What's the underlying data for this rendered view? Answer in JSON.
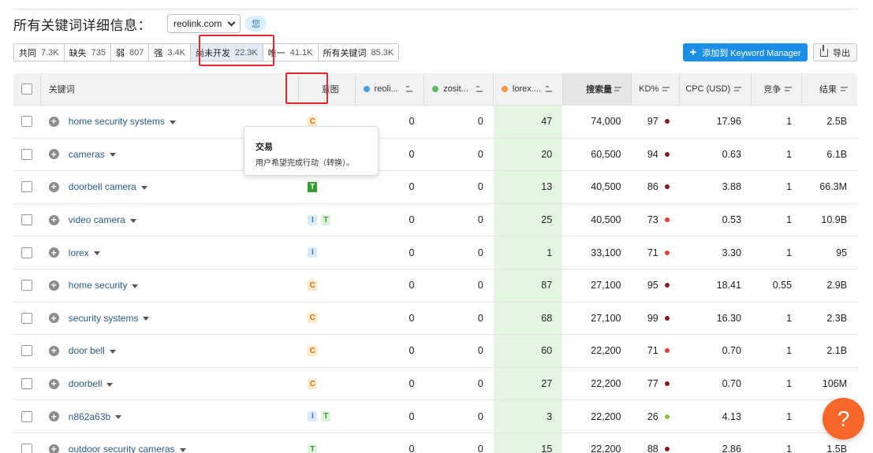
{
  "header": {
    "title": "所有关键词详细信息：",
    "domain": "reolink.com",
    "you_badge": "您"
  },
  "filters": [
    {
      "label": "共同",
      "count": "7.3K"
    },
    {
      "label": "缺失",
      "count": "735"
    },
    {
      "label": "弱",
      "count": "807"
    },
    {
      "label": "强",
      "count": "3.4K"
    },
    {
      "label": "尚未开发",
      "count": "22.3K",
      "active": true
    },
    {
      "label": "唯一",
      "count": "41.1K"
    },
    {
      "label": "所有关键词",
      "count": "85.3K"
    }
  ],
  "actions": {
    "keyword_manager": "添加到 Keyword Manager",
    "export": "导出"
  },
  "table": {
    "headers": {
      "keyword": "关键词",
      "intent": "意图",
      "domain1": "reoli...",
      "domain2": "zosit...",
      "domain3": "lorex....",
      "volume": "搜索量",
      "kd": "KD%",
      "cpc": "CPC (USD)",
      "competition": "竞争",
      "results": "结果"
    },
    "domain_colors": [
      "#4a9ee8",
      "#5cb85c",
      "#f29b38"
    ],
    "rows": [
      {
        "keyword": "home security systems",
        "intents": [
          "C"
        ],
        "d1": "0",
        "d2": "0",
        "d3": "47",
        "volume": "74,000",
        "kd": "97",
        "kd_color": "#8b1a1a",
        "cpc": "17.96",
        "comp": "1",
        "results": "2.5B"
      },
      {
        "keyword": "cameras",
        "intents": [],
        "d1": "0",
        "d2": "0",
        "d3": "20",
        "volume": "60,500",
        "kd": "94",
        "kd_color": "#8b1a1a",
        "cpc": "0.63",
        "comp": "1",
        "results": "6.1B"
      },
      {
        "keyword": "doorbell camera",
        "intents": [
          "T*"
        ],
        "d1": "0",
        "d2": "0",
        "d3": "13",
        "volume": "40,500",
        "kd": "86",
        "kd_color": "#8b1a1a",
        "cpc": "3.88",
        "comp": "1",
        "results": "66.3M"
      },
      {
        "keyword": "video camera",
        "intents": [
          "I",
          "T"
        ],
        "d1": "0",
        "d2": "0",
        "d3": "25",
        "volume": "40,500",
        "kd": "73",
        "kd_color": "#e53935",
        "cpc": "0.53",
        "comp": "1",
        "results": "10.9B"
      },
      {
        "keyword": "lorex",
        "intents": [
          "I"
        ],
        "d1": "0",
        "d2": "0",
        "d3": "1",
        "volume": "33,100",
        "kd": "71",
        "kd_color": "#e53935",
        "cpc": "3.30",
        "comp": "1",
        "results": "95"
      },
      {
        "keyword": "home security",
        "intents": [
          "C"
        ],
        "d1": "0",
        "d2": "0",
        "d3": "87",
        "volume": "27,100",
        "kd": "95",
        "kd_color": "#8b1a1a",
        "cpc": "18.41",
        "comp": "0.55",
        "results": "2.9B"
      },
      {
        "keyword": "security systems",
        "intents": [
          "C"
        ],
        "d1": "0",
        "d2": "0",
        "d3": "68",
        "volume": "27,100",
        "kd": "99",
        "kd_color": "#8b1a1a",
        "cpc": "16.30",
        "comp": "1",
        "results": "2.3B"
      },
      {
        "keyword": "door bell",
        "intents": [
          "C"
        ],
        "d1": "0",
        "d2": "0",
        "d3": "60",
        "volume": "22,200",
        "kd": "71",
        "kd_color": "#e53935",
        "cpc": "0.70",
        "comp": "1",
        "results": "2.1B"
      },
      {
        "keyword": "doorbell",
        "intents": [
          "C"
        ],
        "d1": "0",
        "d2": "0",
        "d3": "27",
        "volume": "22,200",
        "kd": "77",
        "kd_color": "#8b1a1a",
        "cpc": "0.70",
        "comp": "1",
        "results": "106M"
      },
      {
        "keyword": "n862a63b",
        "intents": [
          "I",
          "T"
        ],
        "d1": "0",
        "d2": "0",
        "d3": "3",
        "volume": "22,200",
        "kd": "26",
        "kd_color": "#8bc34a",
        "cpc": "4.13",
        "comp": "1",
        "results": ""
      },
      {
        "keyword": "outdoor security cameras",
        "intents": [
          "T"
        ],
        "d1": "0",
        "d2": "0",
        "d3": "15",
        "volume": "22,200",
        "kd": "88",
        "kd_color": "#8b1a1a",
        "cpc": "2.86",
        "comp": "1",
        "results": "1.5B"
      }
    ]
  },
  "tooltip": {
    "title": "交易",
    "body": "用户希望完成行动（转换）。"
  },
  "help": "?"
}
